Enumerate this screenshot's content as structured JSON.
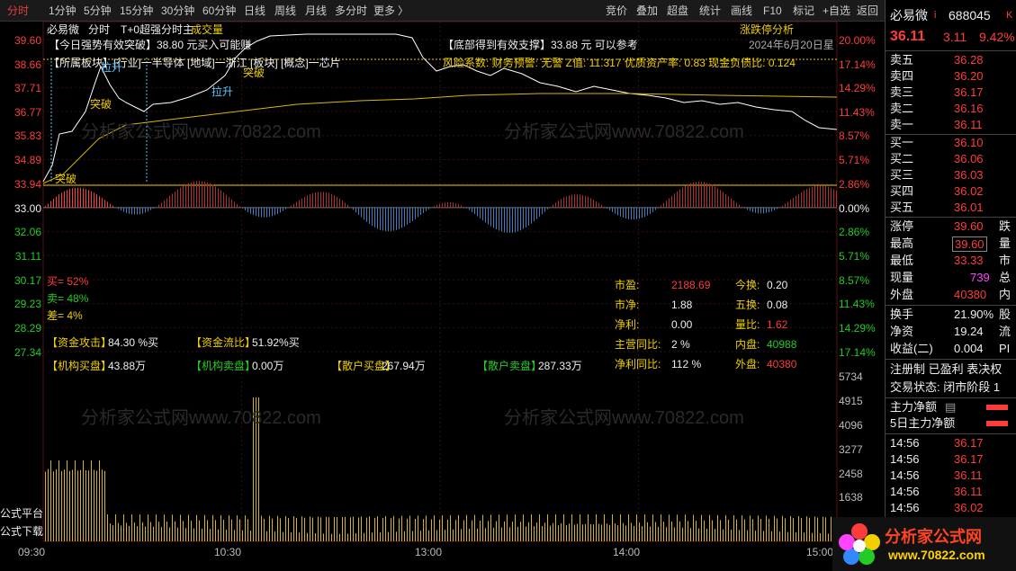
{
  "topbar": {
    "left_tabs": [
      "分时",
      "1分钟",
      "5分钟",
      "15分钟",
      "30分钟",
      "60分钟",
      "日线",
      "周线",
      "月线",
      "多分时",
      "更多"
    ],
    "right_tools": [
      "竞价",
      "叠加",
      "超盘",
      "统计",
      "画线",
      "F10",
      "标记",
      "+自选",
      "返回"
    ]
  },
  "header": {
    "stock_name": "必易微",
    "mode": "分时",
    "indicator": "T+0超强分时主",
    "sub_indicator": "成交量",
    "limit_analysis": "涨跌停分析",
    "date": "2024年6月20日星"
  },
  "annotations": {
    "strong_line": "【今日强势有效突破】38.80 元买入可能赚",
    "support_line": "【底部得到有效支撑】33.88 元 可以参考",
    "sector_line": "【所属板块】[行业]一半导体 [地域]一浙江 [板块] [概念]一芯片",
    "risk_line": "风险系数: 财务预警: 无警 Z值: 11.317 优质资产率: 0.83 现金负债比: 0.124",
    "marks": [
      "拉升",
      "拉升",
      "突破",
      "突破",
      "突破"
    ]
  },
  "axis": {
    "left_prices": [
      "39.60",
      "38.66",
      "37.71",
      "36.77",
      "35.83",
      "34.89",
      "33.94",
      "33.00",
      "32.06",
      "31.11",
      "30.17",
      "29.23",
      "28.29",
      "27.34"
    ],
    "right_pcts": [
      "20.00%",
      "17.14%",
      "14.29%",
      "11.43%",
      "8.57%",
      "5.71%",
      "2.86%",
      "0.00%",
      "2.86%",
      "5.71%",
      "8.57%",
      "11.43%",
      "14.29%",
      "17.14%"
    ],
    "right_volumes": [
      "5734",
      "4915",
      "4096",
      "3277",
      "2458",
      "1638"
    ],
    "times": [
      "09:30",
      "10:30",
      "13:00",
      "14:00",
      "15:00"
    ]
  },
  "buy_sell_ratio": {
    "buy": "买= 52%",
    "sell": "卖= 48%",
    "diff": "差= 4%"
  },
  "fund_flow": {
    "attack_label": "【资金攻击】",
    "attack_value": "84.30 %买",
    "flow_label": "【资金流比】",
    "flow_value": "51.92%买",
    "inst_buy_label": "【机构买盘】",
    "inst_buy_value": "43.88万",
    "inst_sell_label": "【机构卖盘】",
    "inst_sell_value": "0.00万",
    "retail_buy_label": "【散户买盘】",
    "retail_buy_value": "267.94万",
    "retail_sell_label": "【散户卖盘】",
    "retail_sell_value": "287.33万"
  },
  "fundamentals": [
    {
      "label": "市盈:",
      "value": "2188.69",
      "label2": "今换:",
      "value2": "0.20"
    },
    {
      "label": "市净:",
      "value": "1.88",
      "label2": "五换:",
      "value2": "0.08"
    },
    {
      "label": "净利:",
      "value": "0.00",
      "label2": "量比:",
      "value2": "1.62"
    },
    {
      "label": "主营同比:",
      "value": "2 %",
      "label2": "内盘:",
      "value2": "40988"
    },
    {
      "label": "净利同比:",
      "value": "112 %",
      "label2": "外盘:",
      "value2": "40380"
    }
  ],
  "side_labels": {
    "formula_platform": "公式平台",
    "formula_download": "公式下载"
  },
  "quote": {
    "name": "必易微",
    "flag": "i",
    "code": "688045",
    "tag": "K",
    "price": "36.11",
    "change": "3.11",
    "change_pct": "9.42%",
    "asks": [
      {
        "label": "卖五",
        "price": "36.28"
      },
      {
        "label": "卖四",
        "price": "36.20"
      },
      {
        "label": "卖三",
        "price": "36.17"
      },
      {
        "label": "卖二",
        "price": "36.16"
      },
      {
        "label": "卖一",
        "price": "36.11"
      }
    ],
    "bids": [
      {
        "label": "买一",
        "price": "36.10"
      },
      {
        "label": "买二",
        "price": "36.06"
      },
      {
        "label": "买三",
        "price": "36.03"
      },
      {
        "label": "买四",
        "price": "36.02"
      },
      {
        "label": "买五",
        "price": "36.01"
      }
    ],
    "stats": [
      {
        "label": "涨停",
        "value": "39.60",
        "extra": "跌"
      },
      {
        "label": "最高",
        "value": "39.60",
        "extra": "量"
      },
      {
        "label": "最低",
        "value": "33.33",
        "extra": "市"
      },
      {
        "label": "现量",
        "value": "739",
        "extra": "总"
      },
      {
        "label": "外盘",
        "value": "40380",
        "extra": "内"
      }
    ],
    "stats2": [
      {
        "label": "换手",
        "value": "21.90%",
        "extra": "股"
      },
      {
        "label": "净资",
        "value": "19.24",
        "extra": "流"
      },
      {
        "label": "收益(二)",
        "value": "0.004",
        "extra": "PI"
      }
    ],
    "register": "注册制 已盈利 表决权",
    "status": "交易状态: 闭市阶段 1",
    "main_net": "主力净额",
    "main_net5": "5日主力净额",
    "ticks": [
      {
        "time": "14:56",
        "price": "36.17"
      },
      {
        "time": "14:56",
        "price": "36.17"
      },
      {
        "time": "14:56",
        "price": "36.11"
      },
      {
        "time": "14:56",
        "price": "36.11"
      },
      {
        "time": "14:56",
        "price": "36.02"
      }
    ]
  },
  "watermark": {
    "site_name": "分析家公式网",
    "site_url": "www.70822.com"
  },
  "colors": {
    "up": "#ff3c3c",
    "down": "#22cc22",
    "price_line": "#ffffff",
    "avg_line": "#d8b800",
    "accent": "#e04040"
  }
}
